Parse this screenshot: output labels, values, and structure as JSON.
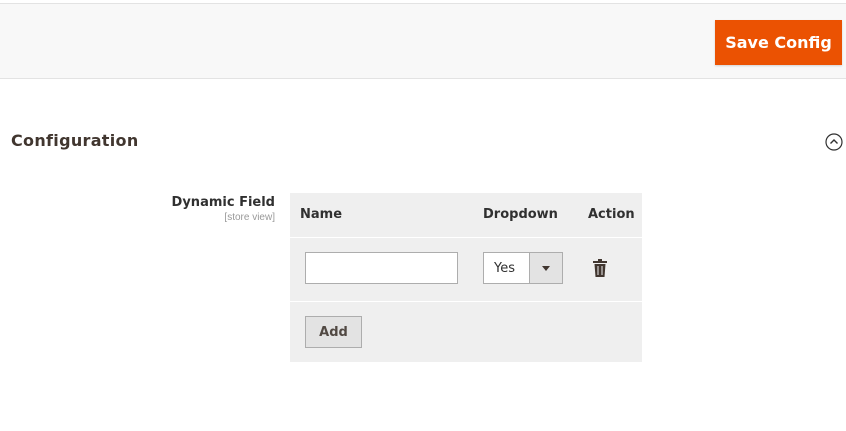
{
  "toolbar": {
    "save_label": "Save Config"
  },
  "section": {
    "title": "Configuration",
    "collapse_icon": "chevron-up-circle-icon"
  },
  "field": {
    "label": "Dynamic Field",
    "scope": "[store view]",
    "table": {
      "columns": [
        "Name",
        "Dropdown",
        "Action"
      ],
      "rows": [
        {
          "name_value": "",
          "dropdown_value": "Yes",
          "action_icon": "trash-icon"
        }
      ],
      "add_label": "Add"
    }
  },
  "colors": {
    "accent": "#eb5202",
    "table_bg": "#efefef",
    "bar_bg": "#f8f8f8"
  }
}
